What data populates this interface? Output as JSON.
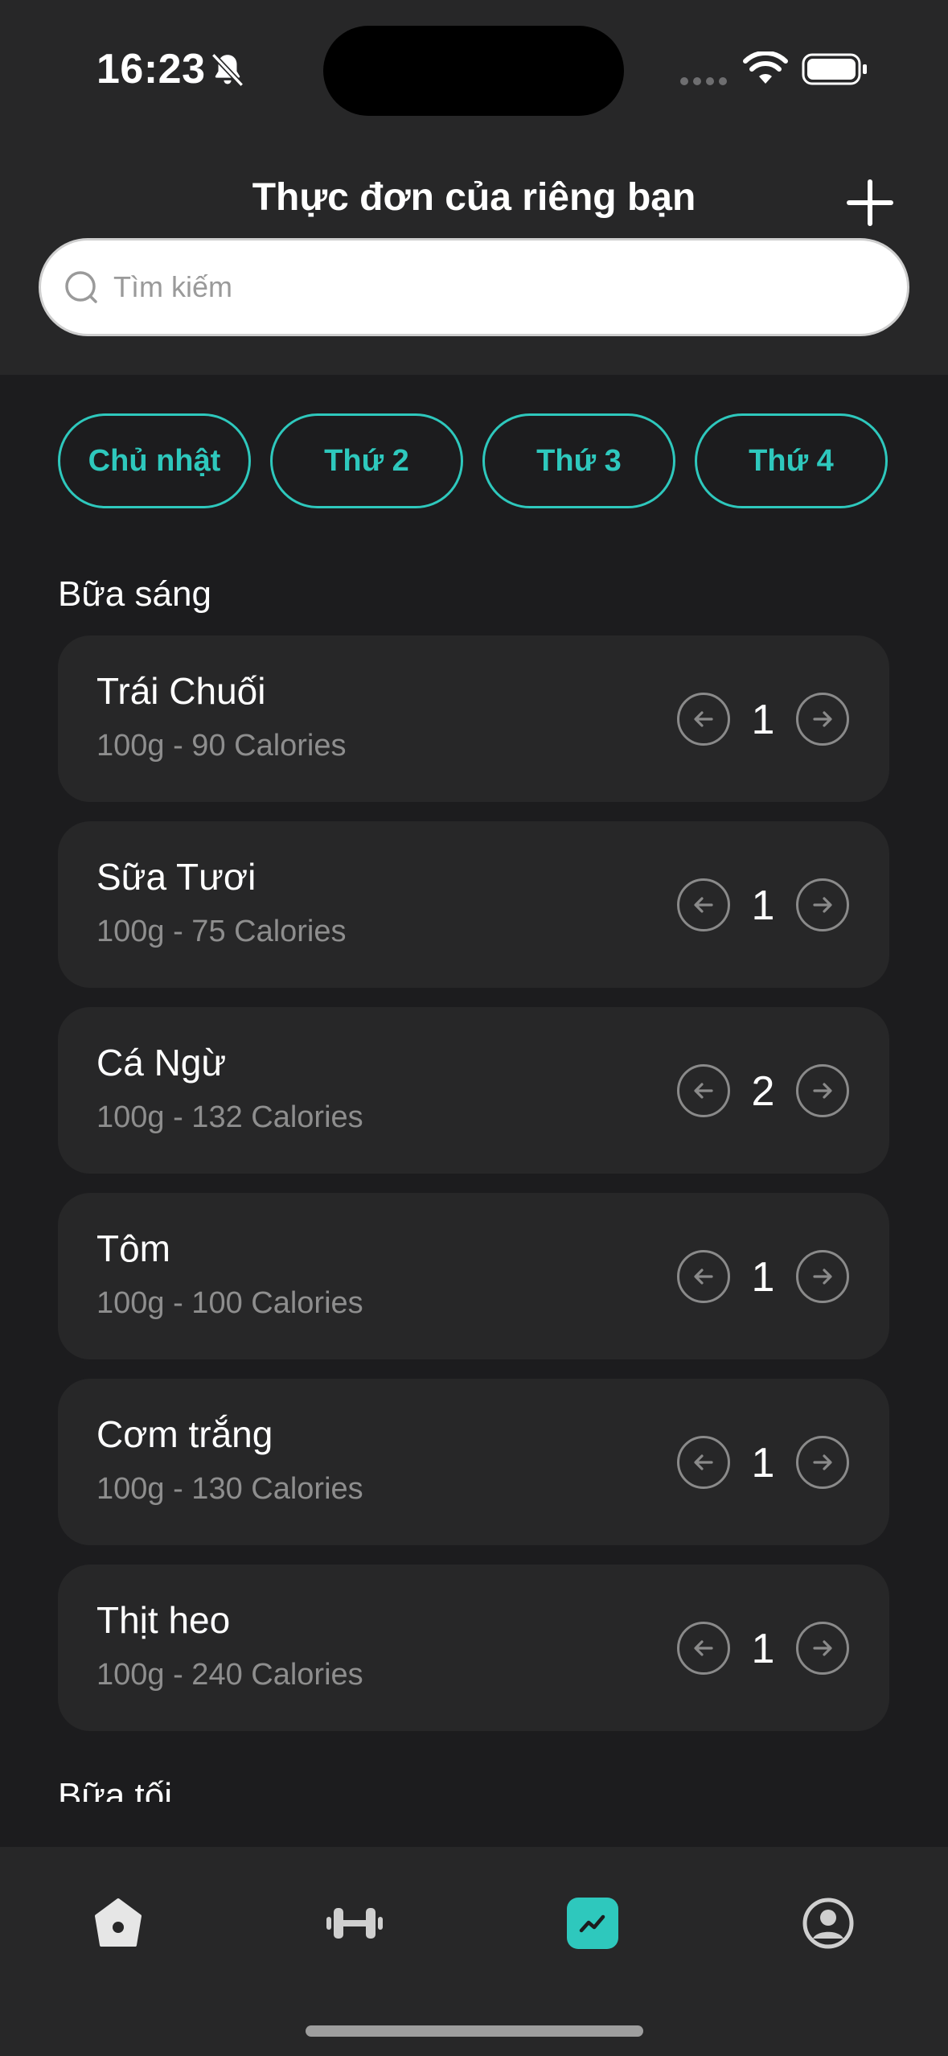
{
  "status_bar": {
    "time": "16:23",
    "icons": [
      "bell-off-icon",
      "signal-icon",
      "wifi-icon",
      "battery-icon"
    ]
  },
  "header": {
    "title": "Thực đơn của riêng bạn",
    "add_icon": "plus-icon"
  },
  "search": {
    "placeholder": "Tìm kiếm",
    "value": ""
  },
  "day_tabs": [
    {
      "label": "Chủ nhật"
    },
    {
      "label": "Thứ 2"
    },
    {
      "label": "Thứ 3"
    },
    {
      "label": "Thứ 4"
    }
  ],
  "breakfast": {
    "title": "Bữa sáng",
    "items": [
      {
        "name": "Trái Chuối",
        "detail": "100g - 90 Calories",
        "qty": "1"
      },
      {
        "name": "Sữa Tươi",
        "detail": "100g - 75 Calories",
        "qty": "1"
      },
      {
        "name": "Cá Ngừ",
        "detail": "100g - 132 Calories",
        "qty": "2"
      },
      {
        "name": "Tôm",
        "detail": "100g - 100 Calories",
        "qty": "1"
      },
      {
        "name": "Cơm trắng",
        "detail": "100g - 130 Calories",
        "qty": "1"
      },
      {
        "name": "Thịt heo",
        "detail": "100g - 240 Calories",
        "qty": "1"
      }
    ]
  },
  "dinner": {
    "title": "Bữa tối"
  },
  "tabbar": {
    "items": [
      "home-icon",
      "dumbbell-icon",
      "chart-icon",
      "profile-icon"
    ],
    "active": "chart-icon"
  },
  "colors": {
    "accent": "#2ec8bd",
    "background": "#1c1c1e",
    "card": "#272728",
    "muted_text": "#8e8e8e"
  }
}
